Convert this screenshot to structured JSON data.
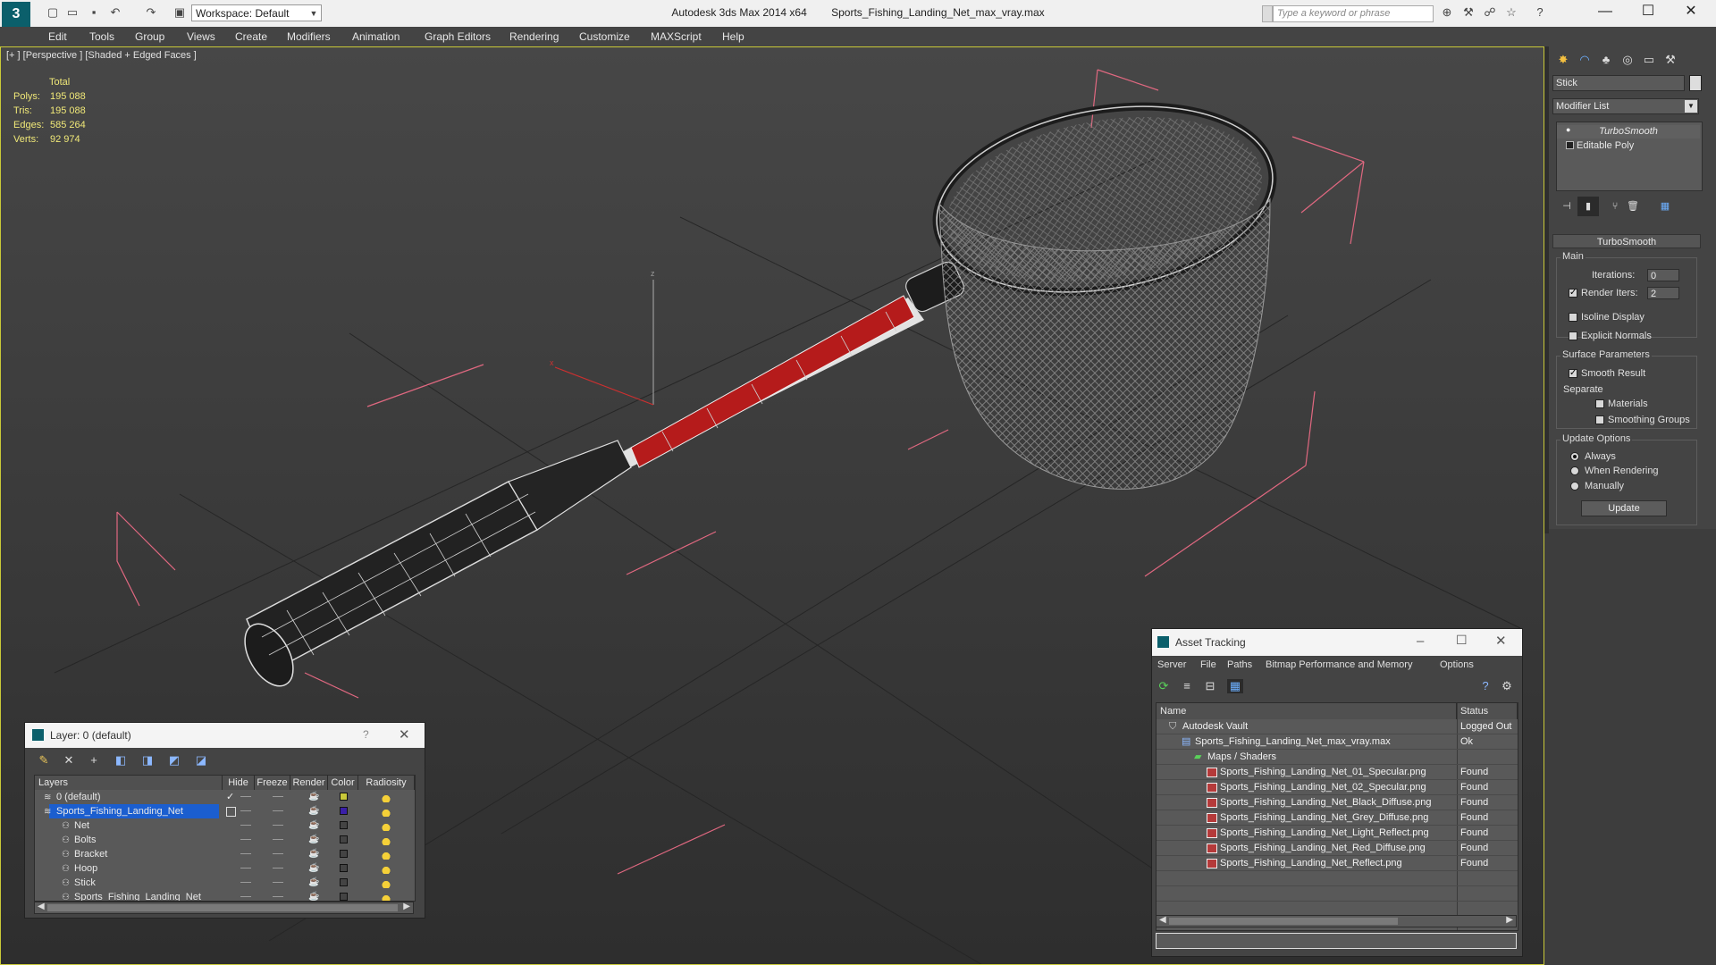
{
  "window": {
    "app_title": "Autodesk 3ds Max 2014 x64",
    "file_title": "Sports_Fishing_Landing_Net_max_vray.max",
    "workspace": "Workspace: Default",
    "search_placeholder": "Type a keyword or phrase"
  },
  "menu": [
    "Edit",
    "Tools",
    "Group",
    "Views",
    "Create",
    "Modifiers",
    "Animation",
    "Graph Editors",
    "Rendering",
    "Customize",
    "MAXScript",
    "Help"
  ],
  "viewport": {
    "label": "[+ ] [Perspective ] [Shaded + Edged Faces ]",
    "stats": {
      "header": "Total",
      "rows": [
        {
          "label": "Polys:",
          "value": "195 088"
        },
        {
          "label": "Tris:",
          "value": "195 088"
        },
        {
          "label": "Edges:",
          "value": "585 264"
        },
        {
          "label": "Verts:",
          "value": "92 974"
        }
      ]
    }
  },
  "command_panel": {
    "object_name": "Stick",
    "modifier_list": "Modifier List",
    "stack": [
      "TurboSmooth",
      "Editable Poly"
    ],
    "rollout_title": "TurboSmooth",
    "main_group": "Main",
    "iterations_label": "Iterations:",
    "iterations_value": "0",
    "render_iters_label": "Render Iters:",
    "render_iters_value": "2",
    "render_iters_checked": true,
    "isoline_label": "Isoline Display",
    "explicit_label": "Explicit Normals",
    "surface_group": "Surface Parameters",
    "smooth_label": "Smooth Result",
    "separate_label": "Separate",
    "materials_label": "Materials",
    "smoothing_groups_label": "Smoothing Groups",
    "update_group": "Update Options",
    "update_options": [
      "Always",
      "When Rendering",
      "Manually"
    ],
    "update_selected": "Always",
    "update_button": "Update"
  },
  "layer_dialog": {
    "title": "Layer: 0 (default)",
    "help": "?",
    "columns": [
      "Layers",
      "Hide",
      "Freeze",
      "Render",
      "Color",
      "Radiosity"
    ],
    "rows": [
      {
        "name": "0 (default)",
        "indent": 0,
        "color": "#c8c83a",
        "selected": false,
        "active": true
      },
      {
        "name": "Sports_Fishing_Landing_Net",
        "indent": 0,
        "color": "#3a1fa8",
        "selected": true,
        "active": false
      },
      {
        "name": "Net",
        "indent": 1,
        "color": "#444444",
        "selected": false,
        "active": false
      },
      {
        "name": "Bolts",
        "indent": 1,
        "color": "#444444",
        "selected": false,
        "active": false
      },
      {
        "name": "Bracket",
        "indent": 1,
        "color": "#444444",
        "selected": false,
        "active": false
      },
      {
        "name": "Hoop",
        "indent": 1,
        "color": "#444444",
        "selected": false,
        "active": false
      },
      {
        "name": "Stick",
        "indent": 1,
        "color": "#444444",
        "selected": false,
        "active": false
      },
      {
        "name": "Sports_Fishing_Landing_Net",
        "indent": 1,
        "color": "#444444",
        "selected": false,
        "active": false
      }
    ]
  },
  "asset_dialog": {
    "title": "Asset Tracking",
    "menu": [
      "Server",
      "File",
      "Paths",
      "Bitmap Performance and Memory",
      "Options"
    ],
    "columns": [
      "Name",
      "Status"
    ],
    "rows": [
      {
        "name": "Autodesk Vault",
        "status": "Logged Out",
        "indent": 0,
        "icon": "vault-icon"
      },
      {
        "name": "Sports_Fishing_Landing_Net_max_vray.max",
        "status": "Ok",
        "indent": 1,
        "icon": "max-file-icon"
      },
      {
        "name": "Maps / Shaders",
        "status": "",
        "indent": 2,
        "icon": "maps-folder-icon"
      },
      {
        "name": "Sports_Fishing_Landing_Net_01_Specular.png",
        "status": "Found",
        "indent": 3,
        "icon": "png-icon"
      },
      {
        "name": "Sports_Fishing_Landing_Net_02_Specular.png",
        "status": "Found",
        "indent": 3,
        "icon": "png-icon"
      },
      {
        "name": "Sports_Fishing_Landing_Net_Black_Diffuse.png",
        "status": "Found",
        "indent": 3,
        "icon": "png-icon"
      },
      {
        "name": "Sports_Fishing_Landing_Net_Grey_Diffuse.png",
        "status": "Found",
        "indent": 3,
        "icon": "png-icon"
      },
      {
        "name": "Sports_Fishing_Landing_Net_Light_Reflect.png",
        "status": "Found",
        "indent": 3,
        "icon": "png-icon"
      },
      {
        "name": "Sports_Fishing_Landing_Net_Red_Diffuse.png",
        "status": "Found",
        "indent": 3,
        "icon": "png-icon"
      },
      {
        "name": "Sports_Fishing_Landing_Net_Reflect.png",
        "status": "Found",
        "indent": 3,
        "icon": "png-icon"
      }
    ]
  },
  "colors": {
    "viewport_border": "#c9c938",
    "stats_text": "#f0e878",
    "selection": "#1b5ecf",
    "handle_red": "#b51b1b",
    "bbox_pink": "#e06880"
  }
}
